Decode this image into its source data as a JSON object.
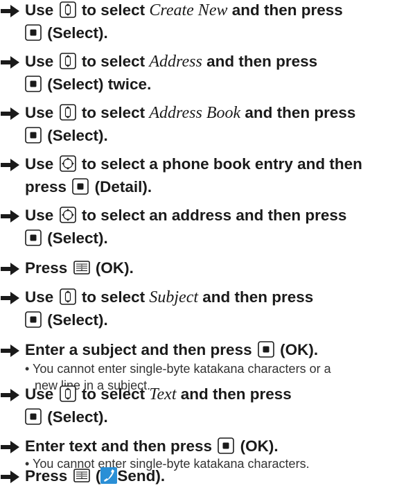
{
  "steps": [
    {
      "l1": {
        "a": "Use",
        "b": "to select",
        "c": "Create New",
        "d": "and then press"
      },
      "l2": {
        "a": "(Select)."
      }
    },
    {
      "l1": {
        "a": "Use",
        "b": "to select",
        "c": "Address",
        "d": "and then press"
      },
      "l2": {
        "a": "(Select) twice."
      }
    },
    {
      "l1": {
        "a": "Use",
        "b": "to select",
        "c": "Address Book",
        "d": "and then press"
      },
      "l2": {
        "a": "(Select)."
      }
    },
    {
      "l1": {
        "a": "Use",
        "b": "to select a phone book entry and then"
      },
      "l2": {
        "a": "press",
        "b": "(Detail)."
      }
    },
    {
      "l1": {
        "a": "Use",
        "b": "to select an address and then press"
      },
      "l2": {
        "a": "(Select)."
      }
    },
    {
      "l1": {
        "a": "Press",
        "b": "(OK)."
      }
    },
    {
      "l1": {
        "a": "Use",
        "b": "to select",
        "c": "Subject",
        "d": "and then press"
      },
      "l2": {
        "a": "(Select)."
      }
    },
    {
      "l1": {
        "a": "Enter a subject and then press",
        "b": "(OK)."
      },
      "note1": "• You cannot enter single-byte katakana characters or a",
      "note2": "new line in a subject."
    },
    {
      "l1": {
        "a": "Use",
        "b": "to select",
        "c": "Text",
        "d": "and then press"
      },
      "l2": {
        "a": "(Select)."
      }
    },
    {
      "l1": {
        "a": "Enter text and then press",
        "b": "(OK)."
      },
      "note1": "• You cannot enter single-byte katakana characters."
    },
    {
      "l1": {
        "a": "Press",
        "b": "(",
        "c": "Send)."
      }
    }
  ],
  "icons": [
    "arrow-icon",
    "updown-key-icon",
    "center-key-icon",
    "multi-key-icon",
    "book-key-icon",
    "phone-icon"
  ],
  "colors": {
    "text": "#1a1a1a",
    "note": "#333333",
    "phone_icon": "#2a8fd6"
  }
}
